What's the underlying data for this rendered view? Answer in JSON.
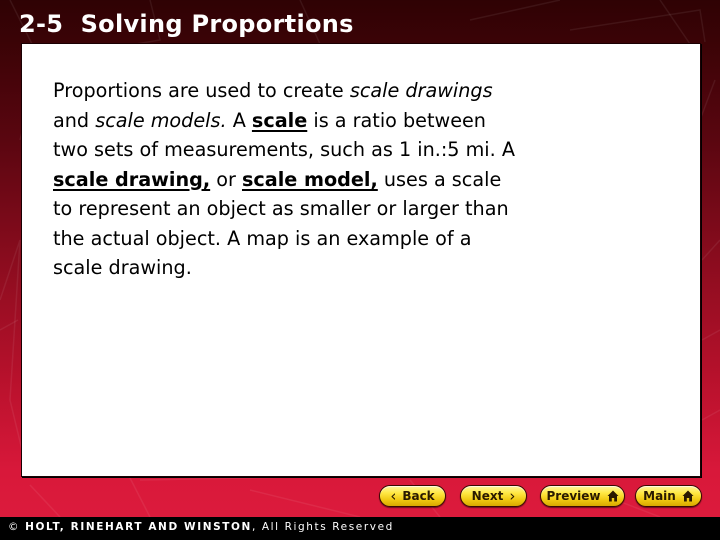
{
  "slide": {
    "title": "2-5  Solving Proportions",
    "lesson_number": "2-5",
    "lesson_name": "Solving Proportions"
  },
  "body": {
    "lines": [
      [
        {
          "text": "Proportions are used to create ",
          "style": "normal"
        },
        {
          "text": "scale drawings",
          "style": "italic"
        }
      ],
      [
        {
          "text": "and ",
          "style": "normal"
        },
        {
          "text": "scale models.",
          "style": "italic"
        },
        {
          "text": " A ",
          "style": "normal"
        },
        {
          "text": "scale",
          "style": "term"
        },
        {
          "text": " is a ratio between",
          "style": "normal"
        }
      ],
      [
        {
          "text": "two sets of measurements, such as 1 in.:5 mi. A",
          "style": "normal"
        }
      ],
      [
        {
          "text": "scale drawing,",
          "style": "term"
        },
        {
          "text": " or ",
          "style": "normal"
        },
        {
          "text": "scale model,",
          "style": "term"
        },
        {
          "text": " uses a scale",
          "style": "normal"
        }
      ],
      [
        {
          "text": "to represent an object as smaller or larger than",
          "style": "normal"
        }
      ],
      [
        {
          "text": "the actual object. A map is an example of a",
          "style": "normal"
        }
      ],
      [
        {
          "text": "scale drawing.",
          "style": "normal"
        }
      ]
    ]
  },
  "navigation": {
    "back_label": "Back",
    "next_label": "Next",
    "preview_label": "Preview",
    "main_label": "Main",
    "back_icon": "chevron-left-icon",
    "next_icon": "chevron-right-icon",
    "home_icon": "house-icon"
  },
  "footer": {
    "copyright_symbol": "©",
    "publisher": "HOLT, RINEHART AND WINSTON",
    "rights": ", All Rights Reserved"
  },
  "colors": {
    "header_dark_red": "#2f0204",
    "bottom_red": "#dc1b3c",
    "button_yellow": "#ffe844",
    "footer_black": "#000000",
    "panel_white": "#ffffff"
  }
}
